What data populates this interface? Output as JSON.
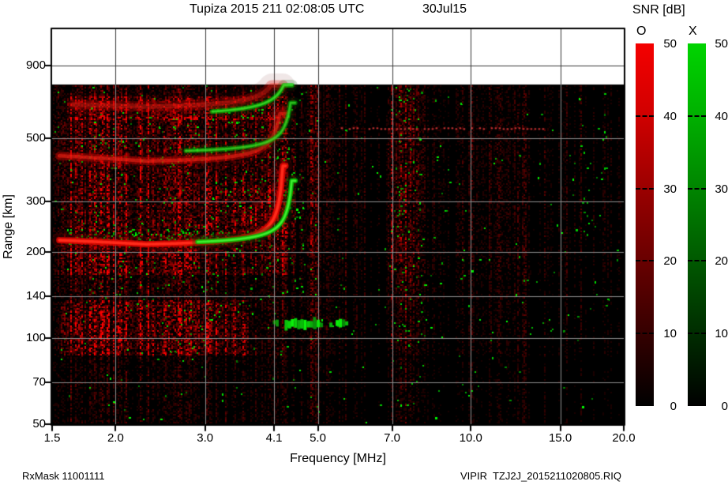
{
  "header": {
    "title": "Tupiza 2015 211 02:08:05 UTC",
    "date": "30Jul15"
  },
  "footer": {
    "rx_mask": "RxMask 11001111",
    "file": "VIPIR  TZJ2J_2015211020805.RIQ"
  },
  "chart_data": {
    "type": "heatmap",
    "title": "Tupiza 2015 211 02:08:05 UTC",
    "date_label": "30Jul15",
    "xlabel": "Frequency [MHz]",
    "ylabel": "Range [km]",
    "x_scale": "log",
    "y_scale": "log",
    "xlim": [
      1.5,
      20
    ],
    "ylim": [
      50,
      1203
    ],
    "x_ticks": [
      1.5,
      2,
      3,
      4.1,
      5,
      7,
      10,
      15,
      20
    ],
    "x_tick_labels": [
      "1.5",
      "2.0",
      "3.0",
      "4.1",
      "5.0",
      "7.0",
      "10.0",
      "15.0",
      "20.0"
    ],
    "y_ticks": [
      50,
      70,
      100,
      140,
      200,
      300,
      500,
      900
    ],
    "data_top_km": 770,
    "grid": true,
    "colorbar": {
      "title": "SNR [dB]",
      "o_label": "O",
      "x_label": "X",
      "o_color": "#ff0000",
      "x_color": "#00cc00",
      "min": 0,
      "max": 50,
      "ticks": [
        50,
        40,
        30,
        20,
        10,
        0
      ]
    },
    "traces": [
      {
        "name": "F-layer O-mode 1st hop",
        "color": "red",
        "f1": 1.55,
        "f2": 4.318,
        "r0": 211,
        "tilt": 9,
        "c": 15,
        "q": 0.9,
        "fc": 4.32,
        "rmax": 400,
        "w": 8,
        "bright": 1.0
      },
      {
        "name": "F-layer X-mode 1st hop",
        "color": "green",
        "f1": 2.9,
        "f2": 4.518,
        "r0": 217,
        "tilt": 0,
        "c": 15,
        "q": 0.9,
        "fc": 4.52,
        "rmax": 355,
        "w": 6,
        "bright": 0.95
      },
      {
        "name": "F-layer O-mode 2nd hop",
        "color": "red",
        "f1": 1.55,
        "f2": 4.312,
        "r0": 412,
        "tilt": 22,
        "c": 30,
        "q": 0.9,
        "fc": 4.32,
        "rmax": 610,
        "w": 10,
        "bright": 0.5
      },
      {
        "name": "F-layer X-mode 2nd hop",
        "color": "green",
        "f1": 2.75,
        "f2": 4.51,
        "r0": 452,
        "tilt": 0,
        "c": 30,
        "q": 0.9,
        "fc": 4.52,
        "rmax": 665,
        "w": 6,
        "bright": 0.6
      },
      {
        "name": "F-layer O-mode 3rd hop",
        "color": "red",
        "f1": 1.65,
        "f2": 4.27,
        "r0": 640,
        "tilt": 18,
        "c": 45,
        "q": 0.9,
        "fc": 4.32,
        "rmax": 766,
        "w": 13,
        "bright": 0.32
      },
      {
        "name": "F-layer X-mode 3rd hop",
        "color": "green",
        "f1": 3.1,
        "f2": 4.45,
        "r0": 620,
        "tilt": 0,
        "c": 50,
        "q": 0.9,
        "fc": 4.52,
        "rmax": 766,
        "w": 6,
        "bright": 0.7
      }
    ],
    "features": {
      "dash_rows": [
        {
          "f": [
            4.13,
            5.68
          ],
          "r": 112,
          "color": "green",
          "duty": 0.62,
          "h": 8,
          "bright": 0.95
        },
        {
          "f": [
            4.3,
            4.95
          ],
          "r": 112,
          "color": "green",
          "duty": 0.8,
          "h": 11,
          "bright": 1.0
        },
        {
          "f": [
            3.85,
            4.1
          ],
          "r": 114,
          "color": "green",
          "duty": 0.4,
          "h": 5,
          "bright": 0.5
        }
      ],
      "dot_rows": [
        {
          "f": [
            5.45,
            13.9
          ],
          "r": 542,
          "color": "#c83232"
        }
      ]
    },
    "noise": {
      "base": 0.5,
      "green_base": 0.0045,
      "bands_f": [
        [
          1.5,
          4.35,
          1.0
        ],
        [
          4.35,
          4.6,
          0.55
        ],
        [
          4.6,
          5.05,
          0.95
        ],
        [
          5.05,
          6.2,
          0.55
        ],
        [
          6.2,
          6.78,
          0.28
        ],
        [
          6.78,
          8.05,
          1.1
        ],
        [
          8.05,
          9.6,
          0.48
        ],
        [
          9.6,
          13.0,
          0.62
        ],
        [
          13.0,
          20.01,
          0.4
        ]
      ],
      "bands_r": [
        [
          50,
          88,
          0.55
        ],
        [
          88,
          136,
          0.8
        ],
        [
          136,
          168,
          0.8
        ],
        [
          168,
          565,
          1.0
        ],
        [
          565,
          771,
          0.9
        ]
      ],
      "hot_zones": [
        {
          "f": [
            1.55,
            3.65
          ],
          "r": [
            88,
            136
          ],
          "m": 2.8
        },
        {
          "f": [
            1.55,
            4.5
          ],
          "r": [
            168,
            600
          ],
          "m": 1.7
        },
        {
          "f": [
            1.6,
            4.35
          ],
          "r": [
            585,
            705
          ],
          "m": 2.5
        },
        {
          "f": [
            2.9,
            4.45
          ],
          "r": [
            228,
            335
          ],
          "m": 1.5
        },
        {
          "f": [
            1.55,
            2.9
          ],
          "r": [
            146,
            215
          ],
          "m": 1.3
        },
        {
          "f": [
            6.78,
            8.05
          ],
          "r": [
            136,
            770
          ],
          "m": 1.25
        }
      ],
      "green_zones": [
        {
          "f": [
            1.8,
            4.7
          ],
          "r": [
            130,
            640
          ],
          "p": 0.02
        },
        {
          "f": [
            7.05,
            8.0
          ],
          "r": [
            95,
            770
          ],
          "p": 0.028
        },
        {
          "f": [
            15.8,
            18.8
          ],
          "r": [
            230,
            570
          ],
          "p": 0.013
        },
        {
          "f": [
            2.35,
            3.2
          ],
          "r": [
            88,
            136
          ],
          "p": 0.02
        },
        {
          "f": [
            1.6,
            3.35
          ],
          "r": [
            213,
            243
          ],
          "p": 0.13
        },
        {
          "f": [
            3.3,
            4.2
          ],
          "r": [
            555,
            640
          ],
          "p": 0.05
        }
      ]
    }
  }
}
